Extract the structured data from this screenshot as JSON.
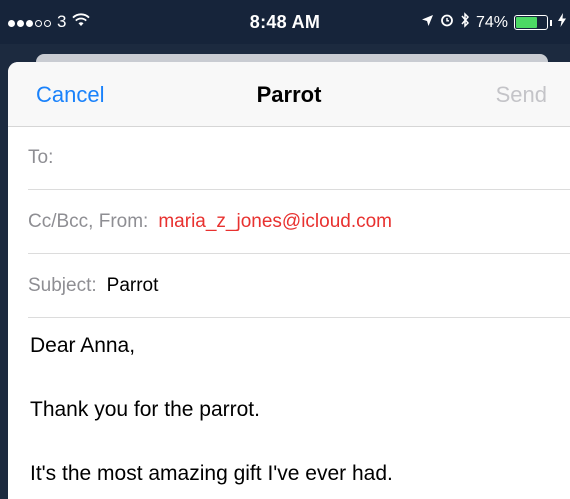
{
  "status_bar": {
    "carrier": "3",
    "signal_icon": "signal-dots",
    "wifi_icon": "wifi-icon",
    "time": "8:48 AM",
    "location_icon": "location-arrow-icon",
    "alarm_icon": "alarm-clock-icon",
    "bluetooth_icon": "bluetooth-icon",
    "battery": "74%",
    "battery_level": 0.74,
    "battery_color": "#4cd964"
  },
  "nav": {
    "cancel": "Cancel",
    "title": "Parrot",
    "send": "Send",
    "accent": "#1a82fb"
  },
  "fields": {
    "to_label": "To:",
    "ccbcc_label": "Cc/Bcc, From:",
    "from_email": "maria_z_jones@icloud.com",
    "subject_label": "Subject:",
    "subject_value": "Parrot"
  },
  "body": {
    "line1": "Dear Anna,",
    "line2": "Thank you for the parrot.",
    "line3": "It's the most amazing gift I've ever had."
  }
}
